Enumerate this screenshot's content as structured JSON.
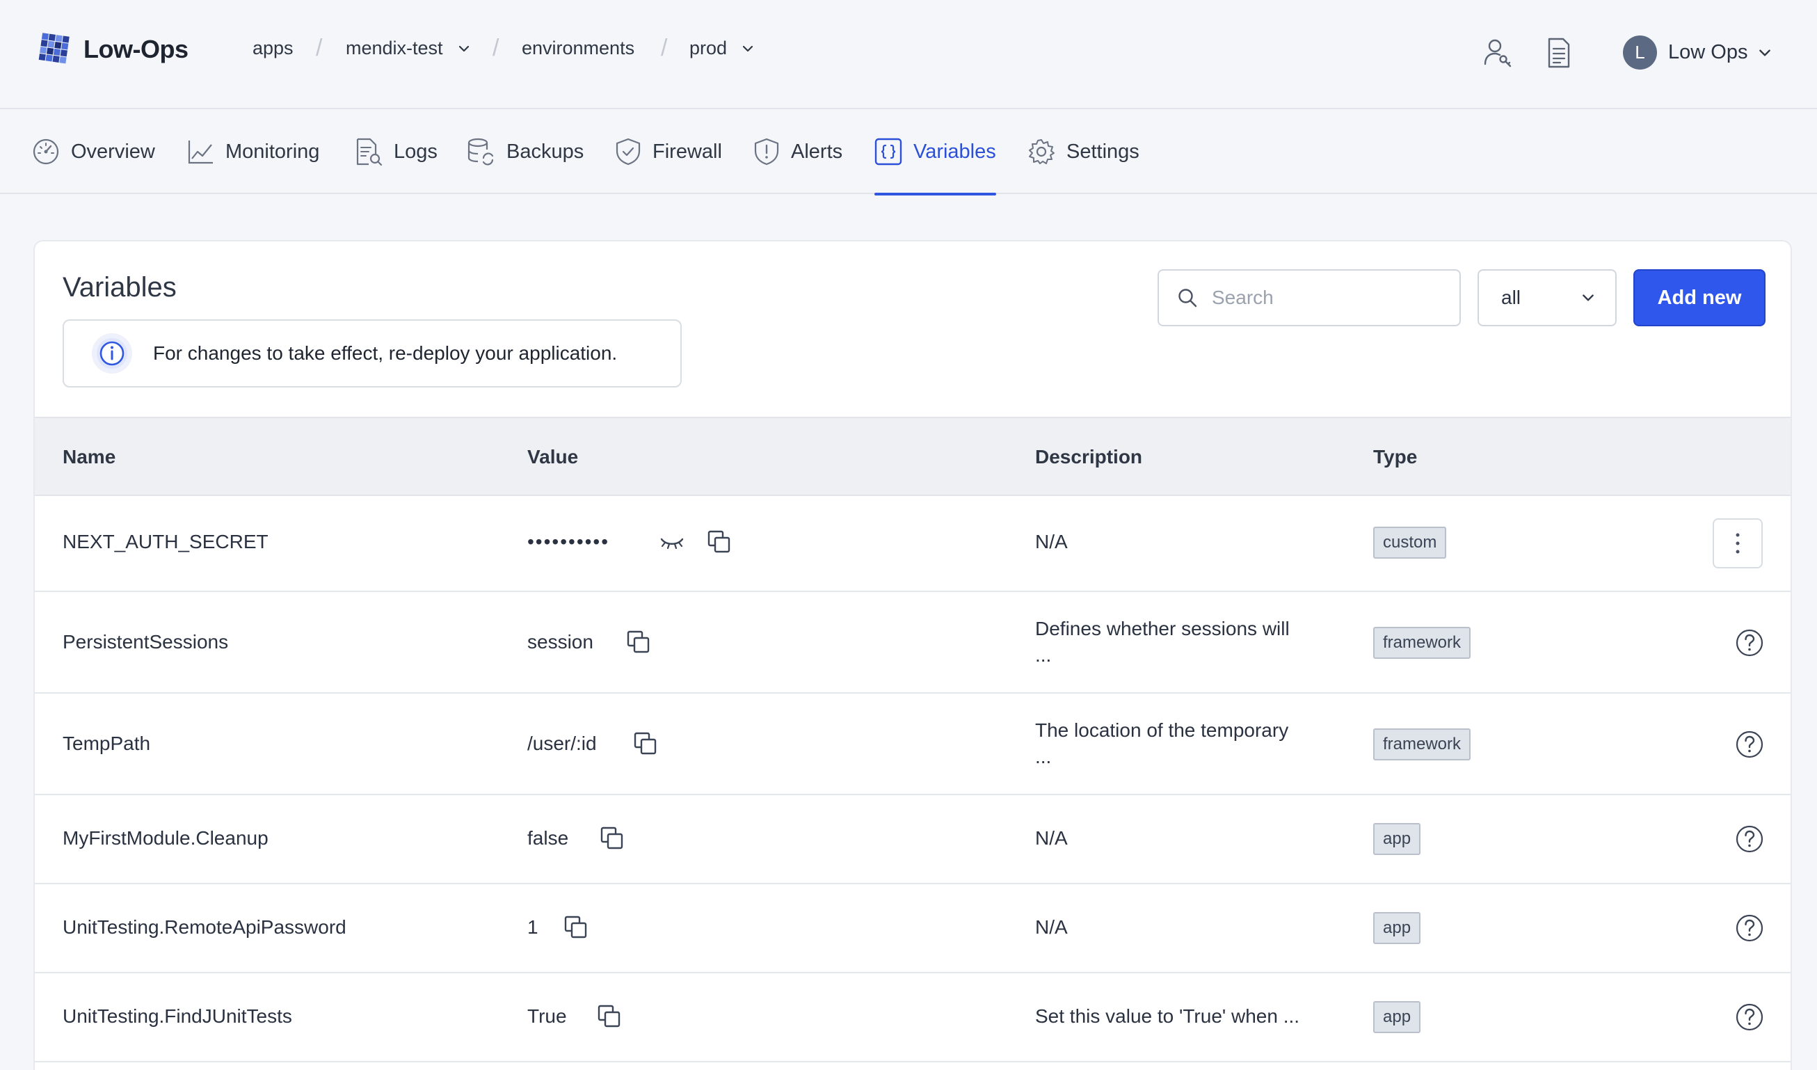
{
  "app": {
    "logo_text": "Low-Ops"
  },
  "breadcrumb": [
    {
      "label": "apps",
      "dropdown": false
    },
    {
      "label": "mendix-test",
      "dropdown": true
    },
    {
      "label": "environments",
      "dropdown": false
    },
    {
      "label": "prod",
      "dropdown": true
    }
  ],
  "header": {
    "icons": [
      "user-key-icon",
      "document-icon"
    ],
    "user": {
      "initial": "L",
      "name": "Low Ops"
    }
  },
  "tabs": [
    {
      "label": "Overview",
      "icon": "gauge-icon"
    },
    {
      "label": "Monitoring",
      "icon": "line-chart-icon"
    },
    {
      "label": "Logs",
      "icon": "log-search-icon"
    },
    {
      "label": "Backups",
      "icon": "database-sync-icon"
    },
    {
      "label": "Firewall",
      "icon": "shield-check-icon"
    },
    {
      "label": "Alerts",
      "icon": "shield-alert-icon"
    },
    {
      "label": "Variables",
      "icon": "braces-icon",
      "active": true
    },
    {
      "label": "Settings",
      "icon": "gear-icon"
    }
  ],
  "page": {
    "title": "Variables",
    "notice": "For changes to take effect, re-deploy your application.",
    "search_placeholder": "Search",
    "filter_value": "all",
    "add_label": "Add new"
  },
  "table": {
    "columns": [
      "Name",
      "Value",
      "Description",
      "Type"
    ],
    "rows": [
      {
        "name": "NEXT_AUTH_SECRET",
        "value": "••••••••••",
        "secret": true,
        "description": [
          "N/A"
        ],
        "type": "custom",
        "action": "more-menu"
      },
      {
        "name": "PersistentSessions",
        "value": "session",
        "description": [
          "Defines whether sessions will",
          "..."
        ],
        "type": "framework",
        "action": "help"
      },
      {
        "name": "TempPath",
        "value": "/user/:id",
        "description": [
          "The location of the temporary",
          "..."
        ],
        "type": "framework",
        "action": "help"
      },
      {
        "name": "MyFirstModule.Cleanup",
        "value": "false",
        "description": [
          "N/A"
        ],
        "type": "app",
        "action": "help"
      },
      {
        "name": "UnitTesting.RemoteApiPassword",
        "value": "1",
        "description": [
          "N/A"
        ],
        "type": "app",
        "action": "help"
      },
      {
        "name": "UnitTesting.FindJUnitTests",
        "value": "True",
        "description": [
          "Set this value to 'True' when ..."
        ],
        "type": "app",
        "action": "help"
      }
    ]
  },
  "colors": {
    "accent": "#2f57eb",
    "active_tab": "#2b4fd8",
    "page_bg": "#f4f6f9",
    "badge_bg": "#dfe3ea"
  }
}
